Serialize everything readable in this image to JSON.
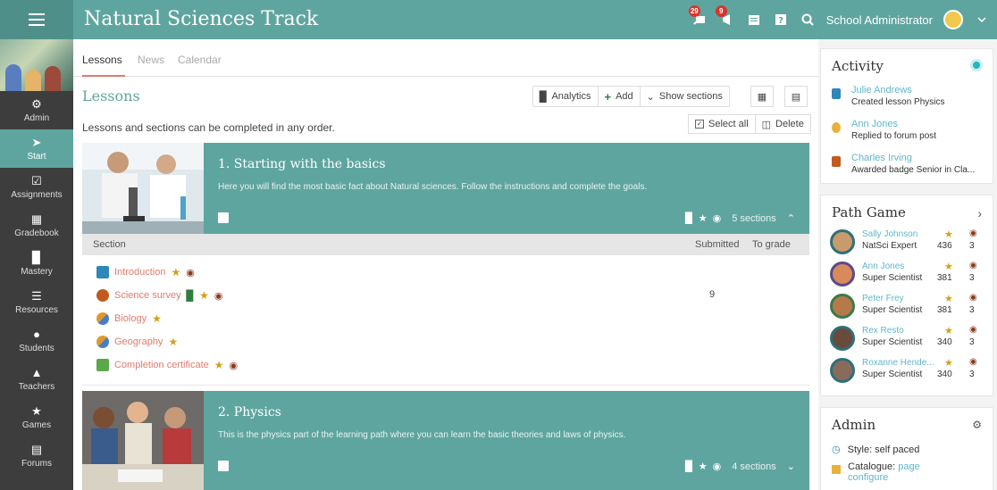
{
  "app": {
    "title": "Natural Sciences Track",
    "user_name": "School Administrator",
    "notif_count_1": "29",
    "notif_count_2": "9"
  },
  "sidebar": {
    "items": [
      {
        "label": "Admin",
        "icon": "gear-icon"
      },
      {
        "label": "Start",
        "icon": "arrow-icon"
      },
      {
        "label": "Assignments",
        "icon": "check-icon"
      },
      {
        "label": "Gradebook",
        "icon": "gradebook-icon"
      },
      {
        "label": "Mastery",
        "icon": "bars-icon"
      },
      {
        "label": "Resources",
        "icon": "resources-icon"
      },
      {
        "label": "Students",
        "icon": "person-icon"
      },
      {
        "label": "Teachers",
        "icon": "teacher-icon"
      },
      {
        "label": "Games",
        "icon": "trophy-icon"
      },
      {
        "label": "Forums",
        "icon": "forum-icon"
      }
    ]
  },
  "tabs": [
    "Lessons",
    "News",
    "Calendar"
  ],
  "main": {
    "heading": "Lessons",
    "intro": "Lessons and sections can be completed in any order.",
    "toolbar": {
      "analytics": "Analytics",
      "add": "Add",
      "show_sections": "Show sections"
    },
    "select_all": "Select all",
    "delete": "Delete"
  },
  "lessons": [
    {
      "title": "1. Starting with the basics",
      "description": "Here you will find the most basic fact about Natural sciences. Follow the instructions and complete the goals.",
      "sections_label": "5 sections"
    },
    {
      "title": "2. Physics",
      "description": "This is the physics part of the learning path where you can learn the basic theories and laws of physics.",
      "sections_label": "4 sections"
    }
  ],
  "section_table": {
    "col_section": "Section",
    "col_submitted": "Submitted",
    "col_to_grade": "To grade",
    "rows": [
      {
        "name": "Introduction",
        "submitted": ""
      },
      {
        "name": "Science survey",
        "submitted": "9"
      },
      {
        "name": "Biology",
        "submitted": ""
      },
      {
        "name": "Geography",
        "submitted": ""
      },
      {
        "name": "Completion certificate",
        "submitted": ""
      }
    ]
  },
  "activity": {
    "title": "Activity",
    "items": [
      {
        "name": "Julie Andrews",
        "desc": "Created lesson Physics"
      },
      {
        "name": "Ann Jones",
        "desc": "Replied to forum post"
      },
      {
        "name": "Charles Irving",
        "desc": "Awarded badge Senior in Cla..."
      }
    ]
  },
  "path_game": {
    "title": "Path Game",
    "players": [
      {
        "name": "Sally Johnson",
        "title": "NatSci Expert",
        "points": "436",
        "badges": "3"
      },
      {
        "name": "Ann Jones",
        "title": "Super Scientist",
        "points": "381",
        "badges": "3"
      },
      {
        "name": "Peter Frey",
        "title": "Super Scientist",
        "points": "381",
        "badges": "3"
      },
      {
        "name": "Rex Resto",
        "title": "Super Scientist",
        "points": "340",
        "badges": "3"
      },
      {
        "name": "Roxanne Hende...",
        "title": "Super Scientist",
        "points": "340",
        "badges": "3"
      }
    ]
  },
  "admin": {
    "title": "Admin",
    "style_label": "Style: self paced",
    "catalogue_label": "Catalogue:",
    "catalogue_link1": "page",
    "catalogue_link2": "configure"
  }
}
